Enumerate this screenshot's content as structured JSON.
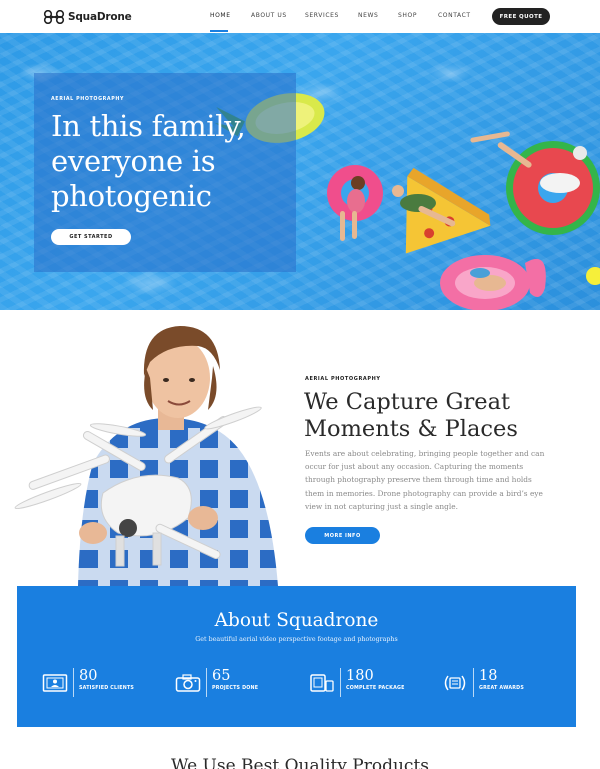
{
  "brand": {
    "name": "SquaDrone"
  },
  "nav": {
    "items": [
      "HOME",
      "ABOUT US",
      "SERVICES",
      "NEWS",
      "SHOP",
      "CONTACT"
    ],
    "active": "HOME",
    "cta": "FREE QUOTE"
  },
  "hero": {
    "kicker": "AERIAL PHOTOGRAPHY",
    "title_lines": [
      "In this family,",
      "everyone is",
      "photogenic"
    ],
    "button": "GET STARTED"
  },
  "capture": {
    "kicker": "AERIAL PHOTOGRAPHY",
    "title_lines": [
      "We Capture Great",
      "Moments & Places"
    ],
    "text_lines": [
      "Events are about celebrating, bringing people together and can",
      "occur for just about any occasion. Capturing the moments",
      "through photography preserve them through time and holds",
      "them in memories. Drone photography can provide a bird’s eye",
      "view in not capturing just a single angle."
    ],
    "button": "MORE INFO"
  },
  "about": {
    "title": "About Squadrone",
    "subtitle": "Get beautiful aerial video perspective footage and photographs",
    "stats": [
      {
        "value": "80",
        "label": "SATISFIED CLIENTS",
        "icon": "id-card-icon"
      },
      {
        "value": "65",
        "label": "PROJECTS DONE",
        "icon": "camera-icon"
      },
      {
        "value": "180",
        "label": "COMPLETE PACKAGE",
        "icon": "devices-icon"
      },
      {
        "value": "18",
        "label": "GREAT AWARDS",
        "icon": "laurel-icon"
      }
    ]
  },
  "products": {
    "title": "We Use Best Quality Products"
  },
  "colors": {
    "accent": "#1a7fe0",
    "dark": "#222222",
    "pool": "#2e9ae6"
  }
}
